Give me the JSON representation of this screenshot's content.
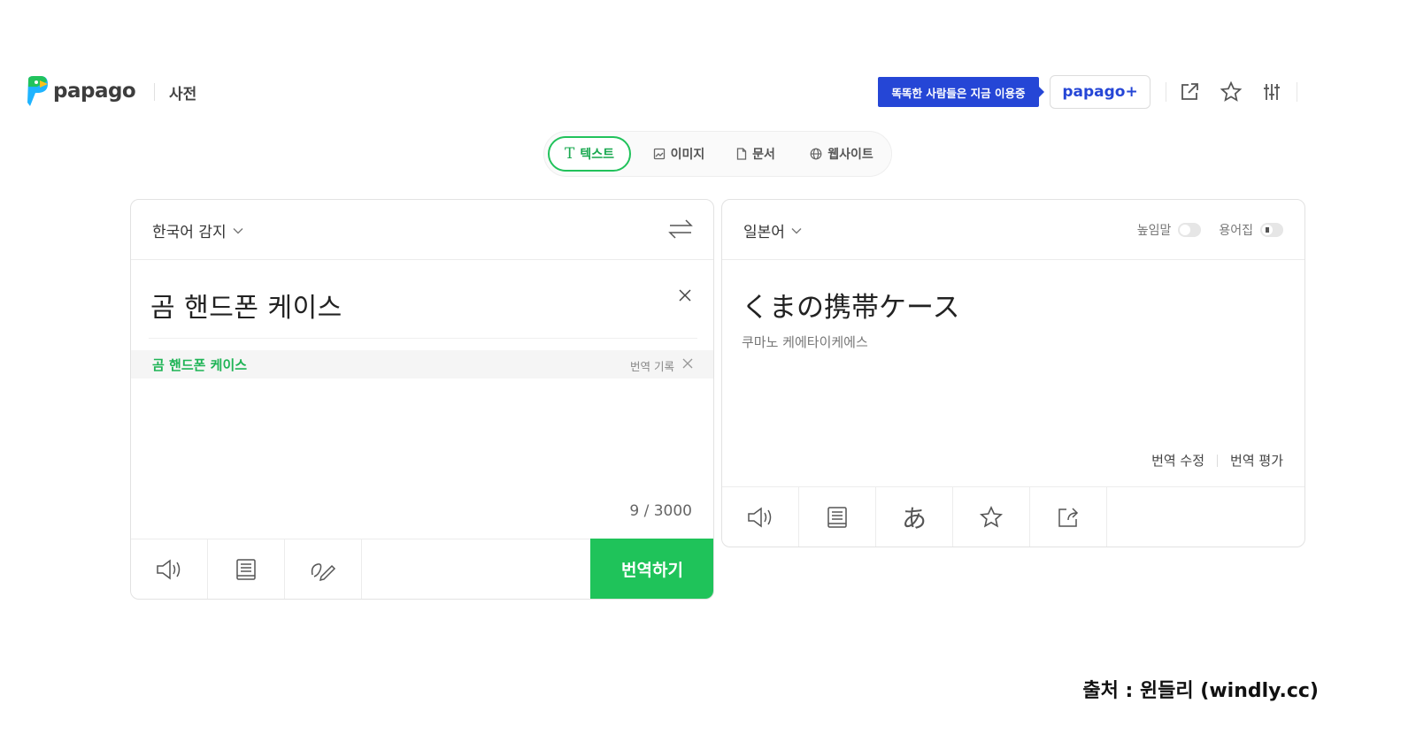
{
  "header": {
    "brand": "papago",
    "dictionary_link": "사전",
    "promo_banner": "똑똑한 사람들은 지금 이용중",
    "papago_plus": "papago+",
    "icons": [
      "external-link-icon",
      "star-icon",
      "settings-sliders-icon"
    ]
  },
  "tabs": [
    {
      "label": "텍스트",
      "icon": "text-t-icon",
      "active": true
    },
    {
      "label": "이미지",
      "icon": "image-icon",
      "active": false
    },
    {
      "label": "문서",
      "icon": "document-icon",
      "active": false
    },
    {
      "label": "웹사이트",
      "icon": "globe-icon",
      "active": false
    }
  ],
  "source": {
    "language": "한국어 감지",
    "text": "곰 핸드폰 케이스",
    "history_item": "곰 핸드폰 케이스",
    "history_label": "번역 기록",
    "char_count": "9 / 3000",
    "translate_button": "번역하기"
  },
  "target": {
    "language": "일본어",
    "honorific_label": "높임말",
    "glossary_label": "용어집",
    "text": "くまの携帯ケース",
    "pronunciation": "쿠마노 케에타이케에스",
    "edit_translation": "번역 수정",
    "rate_translation": "번역 평가"
  },
  "footer": {
    "source_note": "출처 : 윈들리 (windly.cc)"
  },
  "colors": {
    "brand_green": "#1fc35a",
    "promo_blue": "#2546d6"
  }
}
